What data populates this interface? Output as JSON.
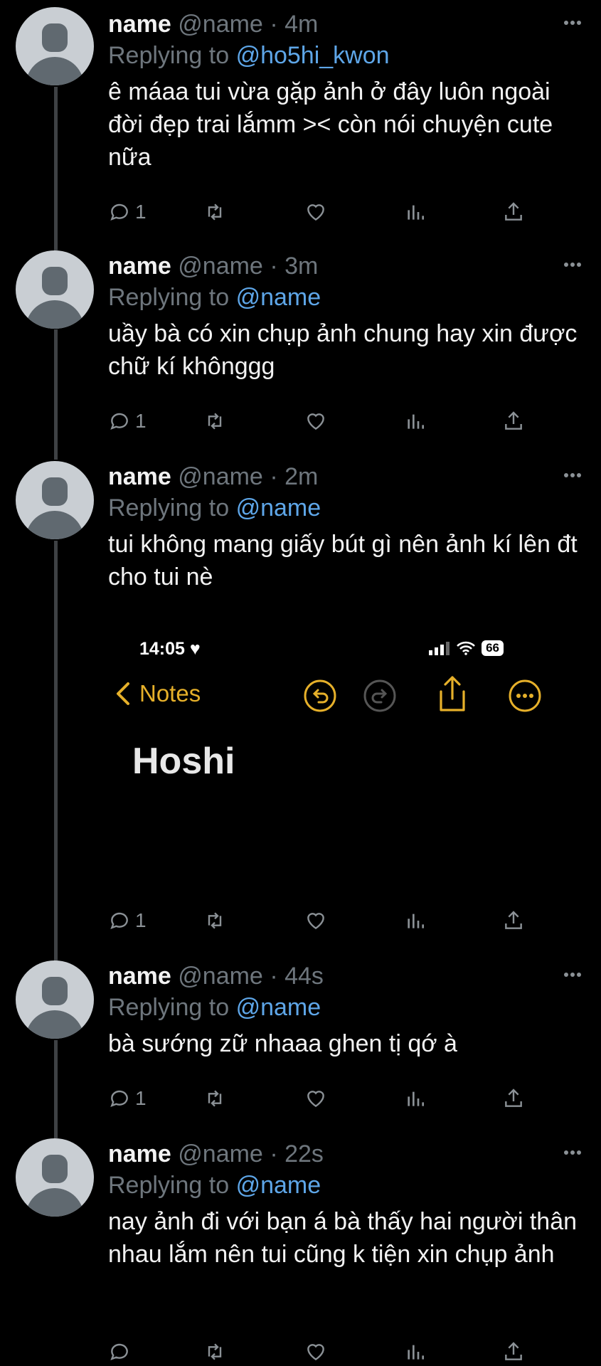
{
  "thread": [
    {
      "name": "name",
      "handle": "@name",
      "time": "4m",
      "replying_label": "Replying to",
      "replying_to": "@ho5hi_kwon",
      "text": "ê máaa tui vừa gặp ảnh ở đây luôn ngoài đời đẹp trai lắmm >< còn nói chuyện cute nữa",
      "reply_count": "1"
    },
    {
      "name": "name",
      "handle": "@name",
      "time": "3m",
      "replying_label": "Replying to",
      "replying_to": "@name",
      "text": "uầy bà có xin chụp ảnh chung hay xin được chữ kí khônggg",
      "reply_count": "1"
    },
    {
      "name": "name",
      "handle": "@name",
      "time": "2m",
      "replying_label": "Replying to",
      "replying_to": "@name",
      "text": "tui không mang giấy bút gì nên ảnh kí lên đt cho tui nè",
      "reply_count": "1",
      "attachment": {
        "status_time": "14:05",
        "battery": "66",
        "back_label": "Notes",
        "note_title": "Hoshi"
      }
    },
    {
      "name": "name",
      "handle": "@name",
      "time": "44s",
      "replying_label": "Replying to",
      "replying_to": "@name",
      "text": "bà sướng zữ nhaaa ghen tị qớ à",
      "reply_count": "1"
    },
    {
      "name": "name",
      "handle": "@name",
      "time": "22s",
      "replying_label": "Replying to",
      "replying_to": "@name",
      "text": "nay ảnh đi với bạn á bà thấy hai người thân nhau lắm nên tui cũng k tiện xin chụp ảnh",
      "reply_count": ""
    }
  ],
  "colors": {
    "mention": "#5ea6e8",
    "notes_accent": "#e6b02a",
    "muted": "#6e767d"
  }
}
